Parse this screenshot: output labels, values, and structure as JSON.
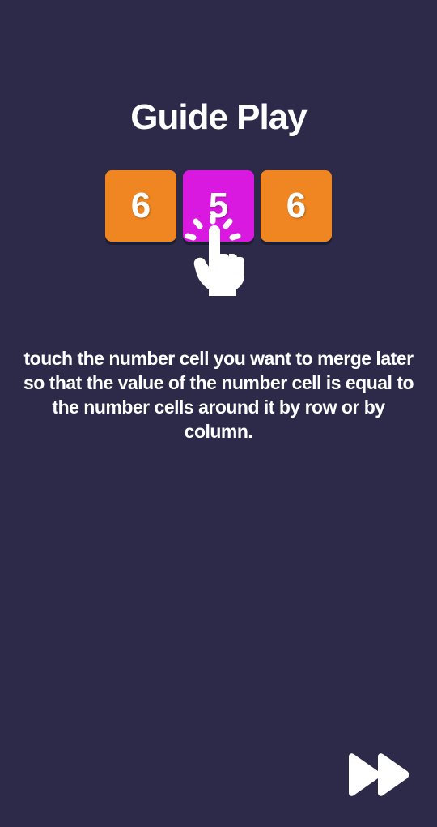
{
  "title": "Guide Play",
  "tiles": [
    {
      "value": "6",
      "color": "orange"
    },
    {
      "value": "5",
      "color": "magenta"
    },
    {
      "value": "6",
      "color": "orange"
    }
  ],
  "instruction": "touch the number cell you want to merge later so that the value of the number cell is equal to the number cells around it by row or by column.",
  "colors": {
    "background": "#2c2949",
    "orange": "#f08622",
    "magenta": "#da19e0",
    "white": "#ffffff"
  }
}
